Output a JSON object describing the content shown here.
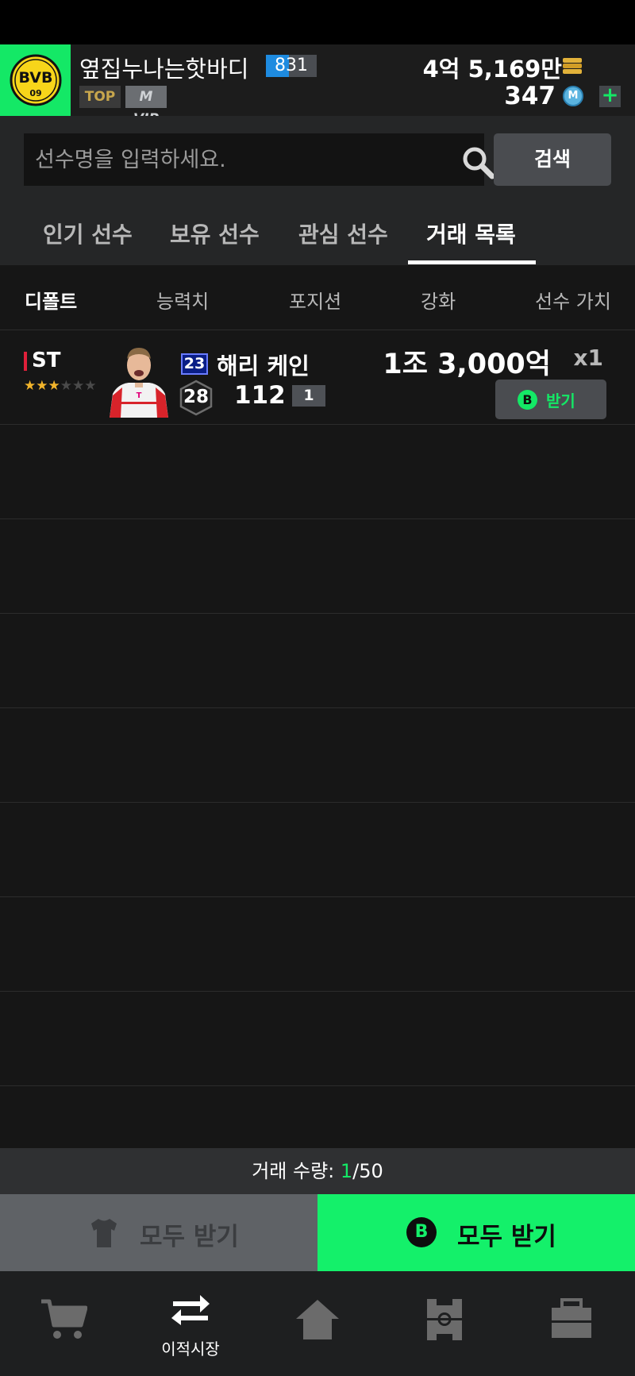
{
  "header": {
    "club_logo_text": "BVB",
    "club_logo_sub": "09",
    "user_name": "옆집누나는핫바디",
    "level": "831",
    "level_progress": 0.45,
    "tag_top": "TOP",
    "tag_vip": "M VIP",
    "gold": "4억 5,169만",
    "mc": "347",
    "mc_icon_letter": "M",
    "plus_label": "+"
  },
  "search": {
    "placeholder": "선수명을 입력하세요.",
    "button_label": "검색"
  },
  "tabs": [
    {
      "label": "인기 선수",
      "active": false
    },
    {
      "label": "보유 선수",
      "active": false
    },
    {
      "label": "관심 선수",
      "active": false
    },
    {
      "label": "거래 목록",
      "active": true
    }
  ],
  "sort_bar": {
    "items": [
      "디폴트",
      "능력치",
      "포지션",
      "강화",
      "선수 가치"
    ],
    "active_index": 0
  },
  "trades": [
    {
      "position": "ST",
      "stars_filled": 3,
      "stars_total": 6,
      "season": "23",
      "name": "해리 케인",
      "ovr": "28",
      "stat": "112",
      "enhance": "1",
      "price": "1조 3,000억",
      "quantity": "x1",
      "receive_icon": "B",
      "receive_label": "받기"
    }
  ],
  "trade_count": {
    "label": "거래 수량: ",
    "current": "1",
    "max": "/50"
  },
  "bottom_actions": {
    "receive_all_gray": "모두 받기",
    "receive_all_green": "모두 받기",
    "green_icon": "B"
  },
  "bottom_nav": [
    {
      "icon": "cart-icon",
      "label": ""
    },
    {
      "icon": "transfer-icon",
      "label": "이적시장"
    },
    {
      "icon": "home-icon",
      "label": ""
    },
    {
      "icon": "field-icon",
      "label": ""
    },
    {
      "icon": "bag-icon",
      "label": ""
    }
  ],
  "colors": {
    "accent_green": "#14e866",
    "position_red": "#e0203a",
    "star_gold": "#f3b52b",
    "season_blue": "#0a1e86"
  }
}
